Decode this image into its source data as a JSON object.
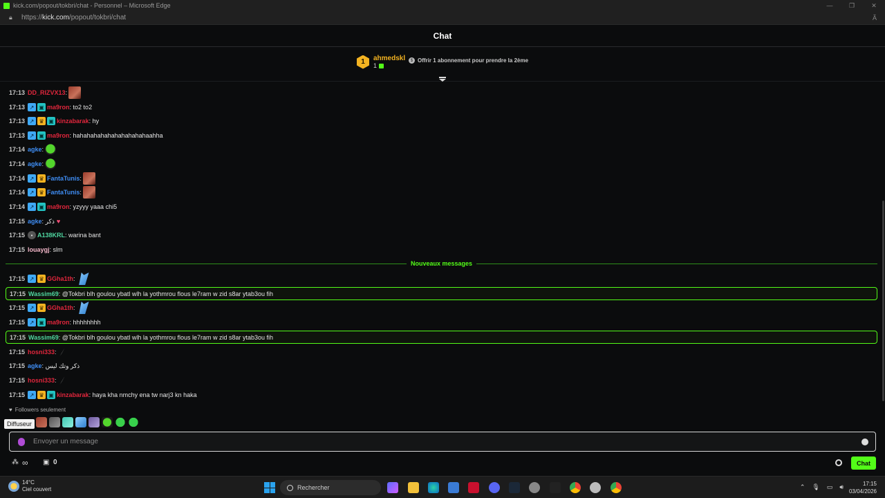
{
  "browser": {
    "window_title": "kick.com/popout/tokbri/chat - Personnel – Microsoft Edge",
    "url_prefix": "https://",
    "url_domain": "kick.com",
    "url_path": "/popout/tokbri/chat"
  },
  "chat": {
    "header": "Chat",
    "pinned": {
      "rank": "1",
      "gifter_name": "ahmedskl",
      "gift_count": "1",
      "offer_text": "Offrir 1 abonnement pour prendre la 2ème"
    },
    "messages": [
      {
        "time": "17:13",
        "badges": [],
        "user": "DD_RIZVX13",
        "user_color": "#e0263c",
        "text": "",
        "emote": "face"
      },
      {
        "time": "17:13",
        "badges": [
          "verified",
          "sub"
        ],
        "user": "ma9ron",
        "user_color": "#e0263c",
        "text": ": to2 to2",
        "emote": ""
      },
      {
        "time": "17:13",
        "badges": [
          "verified",
          "crown",
          "sub"
        ],
        "user": "kinzabarak",
        "user_color": "#e0263c",
        "text": ": hy",
        "emote": ""
      },
      {
        "time": "17:13",
        "badges": [
          "verified",
          "sub"
        ],
        "user": "ma9ron",
        "user_color": "#e0263c",
        "text": ": hahahahahahahahahahahaahha",
        "emote": ""
      },
      {
        "time": "17:14",
        "badges": [],
        "user": "agke",
        "user_color": "#3f8ef5",
        "text": "",
        "emote": "frog"
      },
      {
        "time": "17:14",
        "badges": [],
        "user": "agke",
        "user_color": "#3f8ef5",
        "text": "",
        "emote": "frog"
      },
      {
        "time": "17:14",
        "badges": [
          "verified",
          "crown"
        ],
        "user": "FantaTunis",
        "user_color": "#3f8ef5",
        "text": "",
        "emote": "face"
      },
      {
        "time": "17:14",
        "badges": [
          "verified",
          "crown"
        ],
        "user": "FantaTunis",
        "user_color": "#3f8ef5",
        "text": "",
        "emote": "face"
      },
      {
        "time": "17:14",
        "badges": [
          "verified",
          "sub"
        ],
        "user": "ma9ron",
        "user_color": "#e0263c",
        "text": ": yzyyy yaaa chi5",
        "emote": ""
      },
      {
        "time": "17:15",
        "badges": [],
        "user": "agke",
        "user_color": "#3f8ef5",
        "text": ": ذكر",
        "emote": "heart"
      },
      {
        "time": "17:15",
        "badges": [
          "avatar"
        ],
        "user": "A138KRL",
        "user_color": "#4fd6a0",
        "text": ": warina bant",
        "emote": ""
      },
      {
        "time": "17:15",
        "badges": [],
        "user": "louaygj",
        "user_color": "#f2b6c8",
        "text": ": slm",
        "emote": ""
      },
      {
        "time": "17:15",
        "badges": [
          "verified",
          "crown"
        ],
        "user": "GGha1th",
        "user_color": "#e0263c",
        "text": "",
        "emote": "wing"
      },
      {
        "time": "17:15",
        "badges": [],
        "user": "Wassim69",
        "user_color": "#4fd6a0",
        "text": ": @Tokbri blh goulou ybatl wlh la yothmrou flous le7ram w zid s8ar ytab3ou fih",
        "emote": "",
        "mention": true
      },
      {
        "time": "17:15",
        "badges": [
          "verified",
          "crown"
        ],
        "user": "GGha1th",
        "user_color": "#e0263c",
        "text": "",
        "emote": "wing"
      },
      {
        "time": "17:15",
        "badges": [
          "verified",
          "sub"
        ],
        "user": "ma9ron",
        "user_color": "#e0263c",
        "text": ": hhhhhhhh",
        "emote": ""
      },
      {
        "time": "17:15",
        "badges": [],
        "user": "Wassim69",
        "user_color": "#4fd6a0",
        "text": ": @Tokbri blh goulou ybatl wlh la yothmrou flous le7ram w zid s8ar ytab3ou fih",
        "emote": "",
        "mention": true
      },
      {
        "time": "17:15",
        "badges": [],
        "user": "hosni333",
        "user_color": "#e0263c",
        "text": "",
        "emote": "feather"
      },
      {
        "time": "17:15",
        "badges": [],
        "user": "agke",
        "user_color": "#3f8ef5",
        "text": ": ذكر وتك ليس",
        "emote": ""
      },
      {
        "time": "17:15",
        "badges": [],
        "user": "hosni333",
        "user_color": "#e0263c",
        "text": "",
        "emote": "feather"
      },
      {
        "time": "17:15",
        "badges": [
          "verified",
          "crown",
          "sub"
        ],
        "user": "kinzabarak",
        "user_color": "#e0263c",
        "text": ": haya kha nmchy ena tw narj3 kn haka",
        "emote": ""
      }
    ],
    "new_messages_label": "Nouveaux messages",
    "followers_only": "Followers seulement",
    "tooltip": "Diffuseur",
    "input_placeholder": "Envoyer un message",
    "points": "0",
    "send_label": "Chat",
    "recent_emotes": [
      "face",
      "person",
      "skull",
      "wing",
      "hand",
      "frog",
      "smile",
      "laugh"
    ]
  },
  "taskbar": {
    "temperature": "14°C",
    "weather": "Ciel couvert",
    "search": "Rechercher",
    "time": "17:15",
    "date": "03/04/2026"
  },
  "colors": {
    "accent": "#53fc18",
    "gold": "#f3b321"
  }
}
